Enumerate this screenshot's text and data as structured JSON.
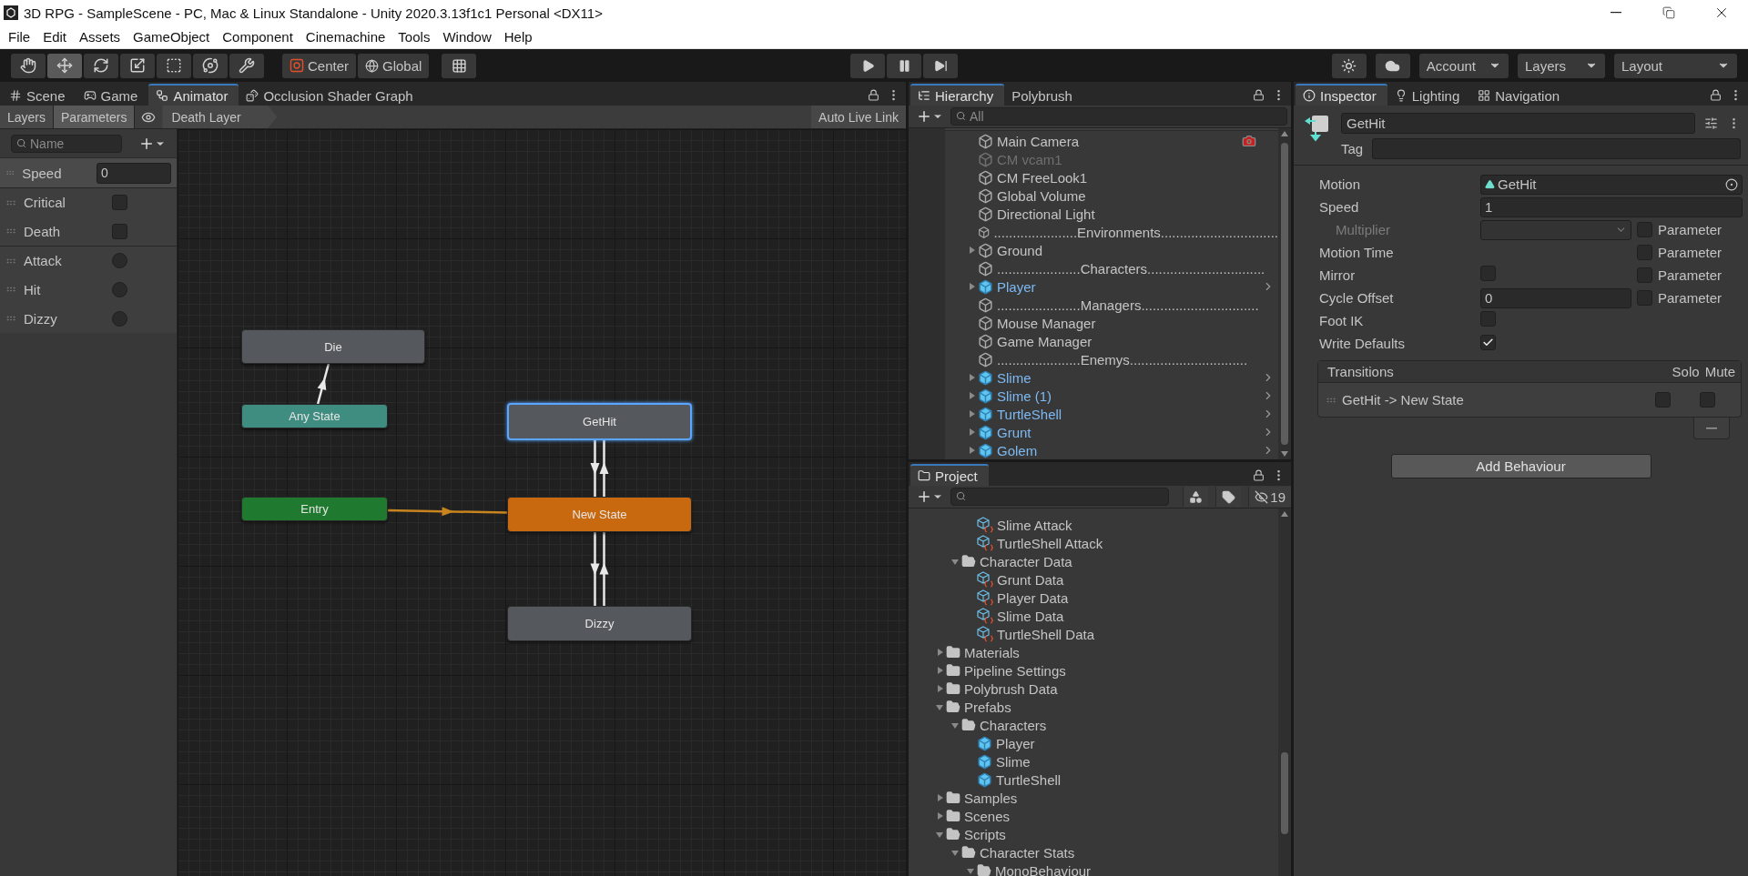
{
  "window": {
    "title": "3D RPG - SampleScene - PC, Mac & Linux Standalone - Unity 2020.3.13f1c1 Personal <DX11>"
  },
  "menu": [
    "File",
    "Edit",
    "Assets",
    "GameObject",
    "Component",
    "Cinemachine",
    "Tools",
    "Window",
    "Help"
  ],
  "toolbar": {
    "tools": [
      {
        "kind": "hand",
        "selected": false
      },
      {
        "kind": "move",
        "selected": true
      },
      {
        "kind": "rotate",
        "selected": false
      },
      {
        "kind": "scale",
        "selected": false
      },
      {
        "kind": "rect",
        "selected": false
      },
      {
        "kind": "transform",
        "selected": false
      },
      {
        "kind": "custom",
        "selected": false
      }
    ],
    "pivot": "Center",
    "space": "Global",
    "playback": [
      {
        "kind": "play"
      },
      {
        "kind": "pause"
      },
      {
        "kind": "step"
      }
    ],
    "dropdowns": [
      "Account",
      "Layers",
      "Layout"
    ]
  },
  "animator": {
    "tabs": [
      {
        "label": "Scene",
        "kind": "scene",
        "selected": false
      },
      {
        "label": "Game",
        "kind": "game",
        "selected": false
      },
      {
        "label": "Animator",
        "kind": "animator",
        "selected": true
      },
      {
        "label": "Occlusion Shader Graph",
        "kind": "shader",
        "selected": false
      }
    ],
    "modes": [
      {
        "label": "Layers",
        "selected": false
      },
      {
        "label": "Parameters",
        "selected": true
      }
    ],
    "layer": "Death Layer",
    "live_link": "Auto Live Link",
    "search_placeholder": "Name",
    "parameters": [
      {
        "name": "Speed",
        "kind": "float",
        "value": "0",
        "selected": true
      },
      {
        "name": "Critical",
        "kind": "bool",
        "checked": false,
        "selected": false
      },
      {
        "name": "Death",
        "kind": "bool",
        "checked": false,
        "selected": false
      },
      {
        "name": "Attack",
        "kind": "trigger",
        "checked": false,
        "selected": false
      },
      {
        "name": "Hit",
        "kind": "trigger",
        "checked": false,
        "selected": false
      },
      {
        "name": "Dizzy",
        "kind": "trigger",
        "checked": false,
        "selected": false
      }
    ],
    "graph": {
      "nodes": [
        {
          "label": "Die",
          "kind": "state",
          "selected": false
        },
        {
          "label": "Any State",
          "kind": "any",
          "selected": false
        },
        {
          "label": "GetHit",
          "kind": "state",
          "selected": true
        },
        {
          "label": "Entry",
          "kind": "entry",
          "selected": false
        },
        {
          "label": "New State",
          "kind": "default",
          "selected": false
        },
        {
          "label": "Dizzy",
          "kind": "state",
          "selected": false
        }
      ]
    }
  },
  "hierarchy": {
    "tabs": [
      {
        "label": "Hierarchy",
        "kind": "hierarchy",
        "selected": true
      },
      {
        "label": "Polybrush",
        "kind": "polybrush",
        "selected": false
      }
    ],
    "search_placeholder": "All",
    "items": [
      {
        "label": "Main Camera",
        "kind": "object",
        "active": true,
        "expandable": false,
        "component_icon": true
      },
      {
        "label": "CM vcam1",
        "kind": "object",
        "active": false,
        "expandable": false,
        "component_icon": false
      },
      {
        "label": "CM FreeLook1",
        "kind": "object",
        "active": true,
        "expandable": false,
        "component_icon": false
      },
      {
        "label": "Global Volume",
        "kind": "object",
        "active": true,
        "expandable": false,
        "component_icon": false
      },
      {
        "label": "Directional Light",
        "kind": "object",
        "active": true,
        "expandable": false,
        "component_icon": false
      },
      {
        "label": "......................Environments...............................",
        "kind": "object",
        "active": true,
        "expandable": false,
        "component_icon": false
      },
      {
        "label": "Ground",
        "kind": "object",
        "active": true,
        "expandable": true,
        "component_icon": false
      },
      {
        "label": "......................Characters...............................",
        "kind": "object",
        "active": true,
        "expandable": false,
        "component_icon": false
      },
      {
        "label": "Player",
        "kind": "prefab",
        "active": true,
        "expandable": true,
        "component_icon": false
      },
      {
        "label": "......................Managers...............................",
        "kind": "object",
        "active": true,
        "expandable": false,
        "component_icon": false
      },
      {
        "label": "Mouse Manager",
        "kind": "object",
        "active": true,
        "expandable": false,
        "component_icon": false
      },
      {
        "label": "Game Manager",
        "kind": "object",
        "active": true,
        "expandable": false,
        "component_icon": false
      },
      {
        "label": "......................Enemys...............................",
        "kind": "object",
        "active": true,
        "expandable": false,
        "component_icon": false
      },
      {
        "label": "Slime",
        "kind": "prefab",
        "active": true,
        "expandable": true,
        "component_icon": false
      },
      {
        "label": "Slime (1)",
        "kind": "prefab",
        "active": true,
        "expandable": true,
        "component_icon": false
      },
      {
        "label": "TurtleShell",
        "kind": "prefab",
        "active": true,
        "expandable": true,
        "component_icon": false
      },
      {
        "label": "Grunt",
        "kind": "prefab",
        "active": true,
        "expandable": true,
        "component_icon": false
      },
      {
        "label": "Golem",
        "kind": "prefab",
        "active": true,
        "expandable": true,
        "component_icon": false
      }
    ]
  },
  "project": {
    "tabs": [
      {
        "label": "Project",
        "kind": "project",
        "selected": true
      }
    ],
    "hidden_count": "19",
    "tree": [
      {
        "children": [
          {
            "children": [
              {
                "label": "Slime Attack",
                "kind": "asset",
                "expandable": false
              },
              {
                "label": "TurtleShell Attack",
                "kind": "asset",
                "expandable": false
              }
            ]
          },
          {
            "label": "Character Data",
            "kind": "folder",
            "expandable": true,
            "expanded": true,
            "children": [
              {
                "label": "Grunt Data",
                "kind": "asset",
                "expandable": false
              },
              {
                "label": "Player Data",
                "kind": "asset",
                "expandable": false
              },
              {
                "label": "Slime Data",
                "kind": "asset",
                "expandable": false
              },
              {
                "label": "TurtleShell Data",
                "kind": "asset",
                "expandable": false
              }
            ]
          }
        ]
      },
      {
        "label": "Materials",
        "kind": "folder",
        "expandable": true,
        "expanded": false
      },
      {
        "label": "Pipeline Settings",
        "kind": "folder",
        "expandable": true,
        "expanded": false
      },
      {
        "label": "Polybrush Data",
        "kind": "folder",
        "expandable": true,
        "expanded": false
      },
      {
        "label": "Prefabs",
        "kind": "folder",
        "expandable": true,
        "expanded": true,
        "children": [
          {
            "label": "Characters",
            "kind": "folder",
            "expandable": true,
            "expanded": true,
            "children": [
              {
                "label": "Player",
                "kind": "prefab",
                "expandable": false
              },
              {
                "label": "Slime",
                "kind": "prefab",
                "expandable": false
              },
              {
                "label": "TurtleShell",
                "kind": "prefab",
                "expandable": false
              }
            ]
          }
        ]
      },
      {
        "label": "Samples",
        "kind": "folder",
        "expandable": true,
        "expanded": false
      },
      {
        "label": "Scenes",
        "kind": "folder",
        "expandable": true,
        "expanded": false
      },
      {
        "label": "Scripts",
        "kind": "folder",
        "expandable": true,
        "expanded": true,
        "children": [
          {
            "label": "Character Stats",
            "kind": "folder",
            "expandable": true,
            "expanded": true,
            "children": [
              {
                "label": "MonoBehaviour",
                "kind": "folder",
                "expandable": true,
                "expanded": true
              }
            ]
          }
        ]
      }
    ]
  },
  "inspector": {
    "tabs": [
      {
        "label": "Inspector",
        "kind": "inspector",
        "selected": true
      },
      {
        "label": "Lighting",
        "kind": "lighting",
        "selected": false
      },
      {
        "label": "Navigation",
        "kind": "navigation",
        "selected": false
      }
    ],
    "name": "GetHit",
    "tag_label": "Tag",
    "properties": [
      {
        "label": "Motion",
        "kind": "object",
        "value": "GetHit",
        "disabled": false
      },
      {
        "label": "Speed",
        "kind": "number",
        "value": "1",
        "disabled": false
      },
      {
        "label": "Multiplier",
        "kind": "dropdown",
        "disabled": true,
        "parameter": {
          "label": "Parameter",
          "checked": false
        }
      },
      {
        "label": "Motion Time",
        "kind": "empty",
        "disabled": false,
        "parameter": {
          "label": "Parameter",
          "checked": false
        }
      },
      {
        "label": "Mirror",
        "kind": "checkbox",
        "checked": false,
        "disabled": false,
        "parameter": {
          "label": "Parameter",
          "checked": false
        }
      },
      {
        "label": "Cycle Offset",
        "kind": "number",
        "value": "0",
        "disabled": false,
        "parameter": {
          "label": "Parameter",
          "checked": false
        }
      },
      {
        "label": "Foot IK",
        "kind": "checkbox",
        "checked": false,
        "disabled": false
      },
      {
        "label": "Write Defaults",
        "kind": "checkbox",
        "checked": true,
        "disabled": false
      }
    ],
    "transitions": {
      "title": "Transitions",
      "columns": [
        "Solo",
        "Mute"
      ],
      "rows": [
        {
          "label": "GetHit -> New State",
          "solo": false,
          "mute": false
        }
      ]
    },
    "add_button": "Add Behaviour"
  }
}
